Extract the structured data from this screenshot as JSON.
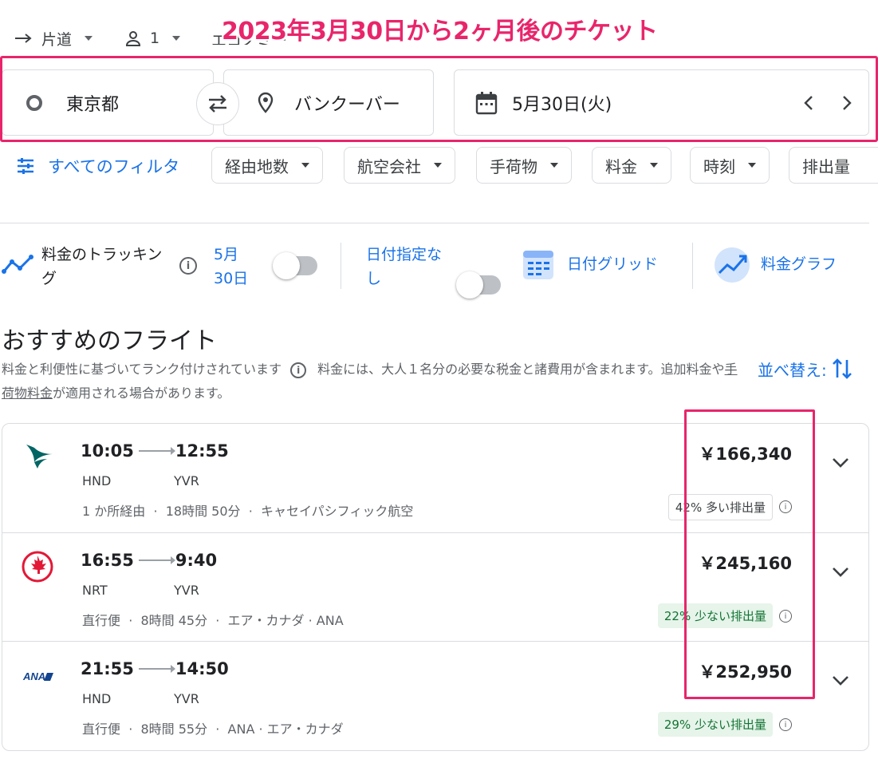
{
  "topbar": {
    "trip_type": "片道",
    "passengers": "1",
    "cabin_partial": "エコノミー"
  },
  "annotation": {
    "title": "2023年3月30日から2ヶ月後のチケット"
  },
  "search": {
    "origin": "東京都",
    "destination": "バンクーバー",
    "date": "5月30日(火)"
  },
  "filters": {
    "all_label": "すべてのフィルタ",
    "chips": [
      "経由地数",
      "航空会社",
      "手荷物",
      "料金",
      "時刻",
      "排出量"
    ]
  },
  "tracking": {
    "label": "料金のトラッキング",
    "date": "5月30日",
    "date_flex": "日付指定なし",
    "date_grid": "日付グリッド",
    "price_graph": "料金グラフ"
  },
  "results_header": {
    "title": "おすすめのフライト",
    "subtitle_1": "料金と利便性に基づいてランク付けされています",
    "subtitle_2": "料金には、大人１名分の必要な税金と諸費用が含まれます。追加料金や",
    "subtitle_link": "手荷物料金",
    "subtitle_3": "が適用される場合があります。",
    "sort_label": "並べ替え:"
  },
  "flights": [
    {
      "airline_logo": "cathay-pacific-logo",
      "depart": "10:05",
      "arrive": "12:55",
      "from": "HND",
      "to": "YVR",
      "stops": "1 か所経由",
      "duration": "18時間 50分",
      "airline": "キャセイパシフィック航空",
      "price": "￥166,340",
      "emissions": "42% 多い排出量",
      "emissions_level": "more"
    },
    {
      "airline_logo": "air-canada-logo",
      "depart": "16:55",
      "arrive": "9:40",
      "from": "NRT",
      "to": "YVR",
      "stops": "直行便",
      "duration": "8時間 45分",
      "airline": "エア・カナダ · ANA",
      "price": "￥245,160",
      "emissions": "22% 少ない排出量",
      "emissions_level": "less"
    },
    {
      "airline_logo": "ana-logo",
      "depart": "21:55",
      "arrive": "14:50",
      "from": "HND",
      "to": "YVR",
      "stops": "直行便",
      "duration": "8時間 55分",
      "airline": "ANA · エア・カナダ",
      "price": "￥252,950",
      "emissions": "29% 少ない排出量",
      "emissions_level": "less"
    }
  ],
  "colors": {
    "accent_blue": "#1a73e8",
    "annotation_pink": "#e8256b",
    "eco_green_bg": "#e6f4ea",
    "eco_green_text": "#137333"
  }
}
